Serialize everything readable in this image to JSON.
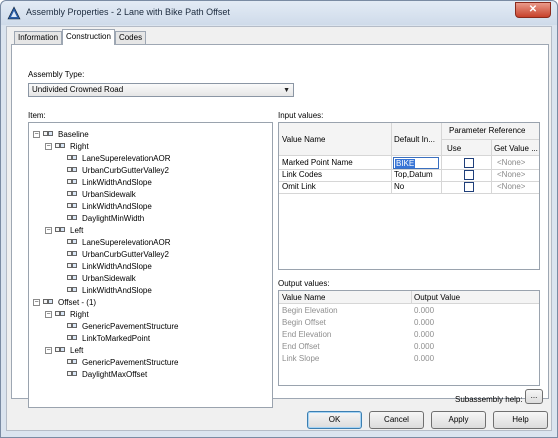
{
  "window": {
    "title": "Assembly Properties - 2 Lane with Bike Path Offset",
    "close_glyph": "✕"
  },
  "tabs": [
    {
      "label": "Information",
      "active": false
    },
    {
      "label": "Construction",
      "active": true
    },
    {
      "label": "Codes",
      "active": false
    }
  ],
  "assembly_type": {
    "label": "Assembly Type:",
    "value": "Undivided Crowned Road"
  },
  "item_label": "Item:",
  "tree": [
    {
      "label": "Baseline",
      "toggle": "−",
      "level": 0
    },
    {
      "label": "Right",
      "toggle": "−",
      "level": 1
    },
    {
      "label": "LaneSuperelevationAOR",
      "level": 2
    },
    {
      "label": "UrbanCurbGutterValley2",
      "level": 2
    },
    {
      "label": "LinkWidthAndSlope",
      "level": 2
    },
    {
      "label": "UrbanSidewalk",
      "level": 2
    },
    {
      "label": "LinkWidthAndSlope",
      "level": 2
    },
    {
      "label": "DaylightMinWidth",
      "level": 2
    },
    {
      "label": "Left",
      "toggle": "−",
      "level": 1
    },
    {
      "label": "LaneSuperelevationAOR",
      "level": 2
    },
    {
      "label": "UrbanCurbGutterValley2",
      "level": 2
    },
    {
      "label": "LinkWidthAndSlope",
      "level": 2
    },
    {
      "label": "UrbanSidewalk",
      "level": 2
    },
    {
      "label": "LinkWidthAndSlope",
      "level": 2
    },
    {
      "label": "Offset - (1)",
      "toggle": "−",
      "level": 0
    },
    {
      "label": "Right",
      "toggle": "−",
      "level": 1
    },
    {
      "label": "GenericPavementStructure",
      "level": 2
    },
    {
      "label": "LinkToMarkedPoint",
      "level": 2
    },
    {
      "label": "Left",
      "toggle": "−",
      "level": 1
    },
    {
      "label": "GenericPavementStructure",
      "level": 2
    },
    {
      "label": "DaylightMaxOffset",
      "level": 2
    }
  ],
  "input_values": {
    "label": "Input values:",
    "headers": {
      "value_name": "Value Name",
      "default_input": "Default In...",
      "param_ref": "Parameter Reference",
      "use": "Use",
      "get_value": "Get Value ..."
    },
    "rows": [
      {
        "name": "Marked Point Name",
        "default": "BIKE",
        "use": false,
        "get_value": "<None>"
      },
      {
        "name": "Link Codes",
        "default": "Top,Datum",
        "use": false,
        "get_value": "<None>"
      },
      {
        "name": "Omit Link",
        "default": "No",
        "use": false,
        "get_value": "<None>"
      }
    ]
  },
  "output_values": {
    "label": "Output values:",
    "headers": {
      "value_name": "Value Name",
      "output_value": "Output Value"
    },
    "rows": [
      {
        "name": "Begin Elevation",
        "value": "0.000"
      },
      {
        "name": "Begin Offset",
        "value": "0.000"
      },
      {
        "name": "End Elevation",
        "value": "0.000"
      },
      {
        "name": "End Offset",
        "value": "0.000"
      },
      {
        "name": "Link Slope",
        "value": "0.000"
      }
    ]
  },
  "subassembly_help": {
    "label": "Subassembly help:",
    "button": "..."
  },
  "buttons": {
    "ok": "OK",
    "cancel": "Cancel",
    "apply": "Apply",
    "help": "Help"
  },
  "icons": {
    "app": "civil3d-app-icon",
    "close": "close-icon",
    "dropdown": "chevron-down-icon",
    "tree_node": "assembly-node-icon"
  },
  "colors": {
    "selection": "#3875d7",
    "checkbox_border": "#1f3f7a"
  }
}
